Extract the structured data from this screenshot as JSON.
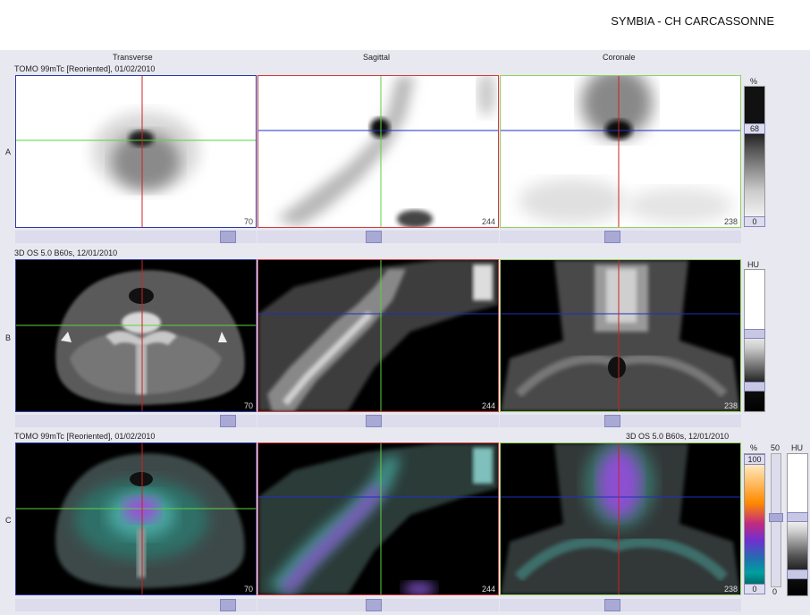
{
  "header": {
    "title": "SYMBIA - CH CARCASSONNE"
  },
  "columns": {
    "transverse": "Transverse",
    "sagittal": "Sagittal",
    "coronal": "Coronale"
  },
  "rows": {
    "a": {
      "letter": "A",
      "series": "TOMO 99mTc [Reoriented], 01/02/2010"
    },
    "b": {
      "letter": "B",
      "series": "3D  OS  5.0  B60s, 12/01/2010"
    },
    "c": {
      "letter": "C",
      "series_left": "TOMO 99mTc [Reoriented], 01/02/2010",
      "series_right": "3D  OS  5.0  B60s, 12/01/2010"
    }
  },
  "slices": {
    "transverse": "70",
    "sagittal": "244",
    "coronal": "238"
  },
  "scales": {
    "a": {
      "unit": "%",
      "top": "68",
      "bottom": "0"
    },
    "b": {
      "unit": "HU"
    },
    "c": {
      "unit_left": "%",
      "top_left": "100",
      "bottom_left": "0",
      "mid": "50",
      "mid_bottom": "0",
      "unit_right": "HU"
    }
  },
  "colors": {
    "transverse_frame": "#2b3aa8",
    "sagittal_frame": "#d43a3a",
    "coronal_frame": "#8fd060",
    "crosshair_red": "#d02020",
    "crosshair_green": "#5ed040",
    "crosshair_blue": "#2030c0"
  }
}
